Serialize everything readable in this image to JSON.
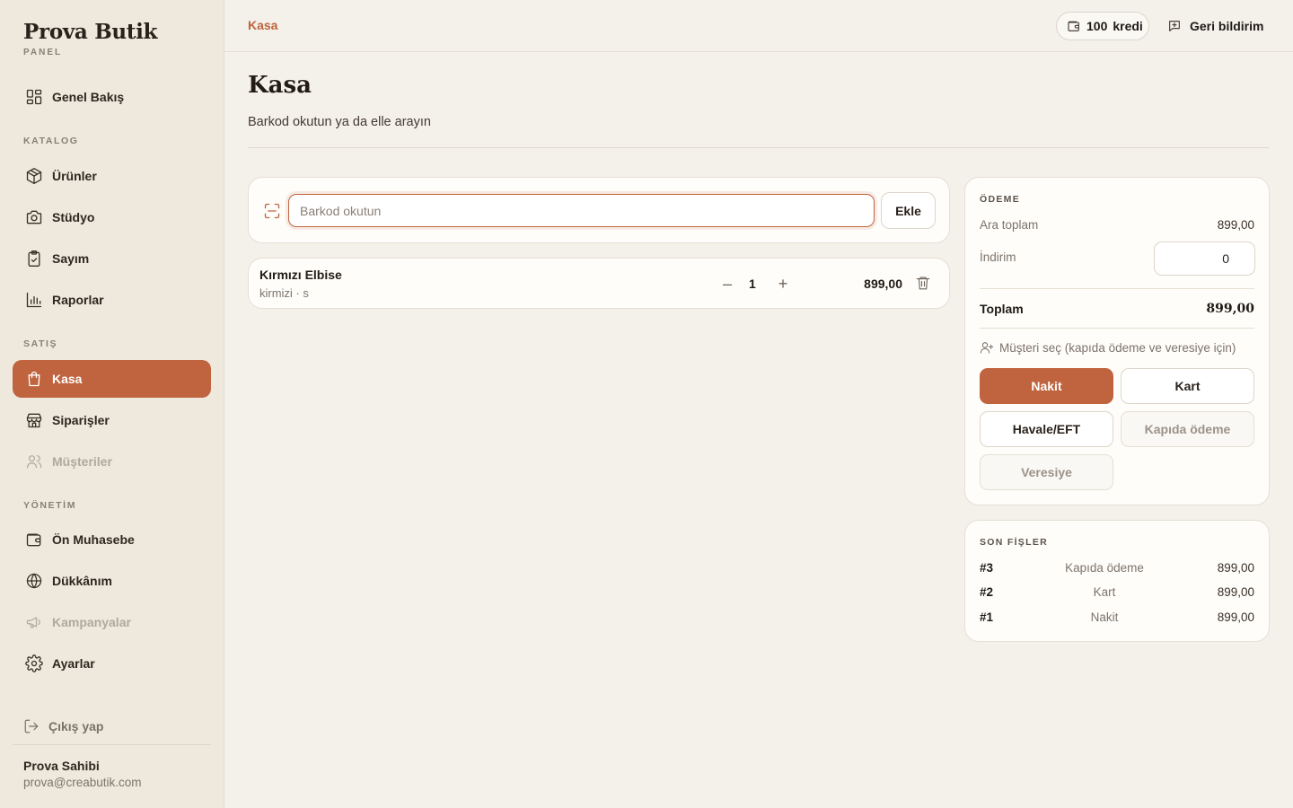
{
  "brand": {
    "name": "Prova Butik",
    "sub": "PANEL"
  },
  "sidebar": {
    "overview": "Genel Bakış",
    "sections": {
      "catalog": "KATALOG",
      "sales": "SATIŞ",
      "management": "YÖNETİM"
    },
    "items": {
      "products": "Ürünler",
      "studio": "Stüdyo",
      "count": "Sayım",
      "reports": "Raporlar",
      "checkout": "Kasa",
      "orders": "Siparişler",
      "customers": "Müşteriler",
      "accounting": "Ön Muhasebe",
      "shop": "Dükkânım",
      "campaigns": "Kampanyalar",
      "settings": "Ayarlar"
    },
    "logout": "Çıkış yap",
    "user": {
      "name": "Prova Sahibi",
      "email": "prova@creabutik.com"
    }
  },
  "topbar": {
    "breadcrumb": "Kasa",
    "credit_amount": "100",
    "credit_unit": "kredi",
    "feedback": "Geri bildirim"
  },
  "page": {
    "title": "Kasa",
    "subtitle": "Barkod okutun ya da elle arayın"
  },
  "scan": {
    "placeholder": "Barkod okutun",
    "value": "",
    "add_label": "Ekle"
  },
  "cart": {
    "items": [
      {
        "name": "Kırmızı Elbise",
        "variant": "kirmizi · s",
        "qty": "1",
        "price": "899,00"
      }
    ]
  },
  "payment": {
    "title": "ÖDEME",
    "subtotal_label": "Ara toplam",
    "subtotal_value": "899,00",
    "discount_label": "İndirim",
    "discount_value": "0",
    "total_label": "Toplam",
    "total_value": "899,00",
    "customer_label": "Müşteri seç",
    "customer_hint": "(kapıda ödeme ve veresiye için)",
    "methods": {
      "cash": "Nakit",
      "card": "Kart",
      "transfer": "Havale/EFT",
      "cod": "Kapıda ödeme",
      "credit": "Veresiye"
    },
    "selected": "cash"
  },
  "receipts": {
    "title": "SON FİŞLER",
    "rows": [
      {
        "id": "#3",
        "method": "Kapıda ödeme",
        "amount": "899,00"
      },
      {
        "id": "#2",
        "method": "Kart",
        "amount": "899,00"
      },
      {
        "id": "#1",
        "method": "Nakit",
        "amount": "899,00"
      }
    ]
  },
  "colors": {
    "accent": "#c0643f",
    "sidebar_bg": "#efe8dc",
    "page_bg": "#f4f1ea"
  },
  "icons": [
    "grid-icon",
    "box-icon",
    "camera-icon",
    "clipboard-icon",
    "bar-chart-icon",
    "shopping-bag-icon",
    "store-icon",
    "users-icon",
    "wallet-icon",
    "globe-icon",
    "megaphone-icon",
    "gear-icon",
    "logout-icon",
    "scan-icon",
    "trash-icon",
    "user-plus-icon",
    "message-plus-icon"
  ]
}
